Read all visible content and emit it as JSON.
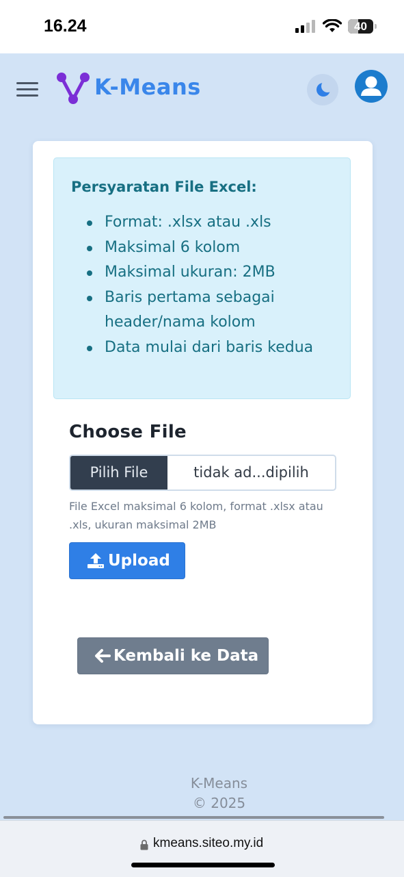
{
  "status_bar": {
    "time": "16.24",
    "battery_level": "40"
  },
  "header": {
    "brand": "K-Means",
    "icons": [
      "menu-icon",
      "logo-icon",
      "moon-icon",
      "user-icon"
    ]
  },
  "requirements": {
    "title": "Persyaratan File Excel:",
    "items": [
      "Format: .xlsx atau .xls",
      "Maksimal 6 kolom",
      "Maksimal ukuran: 2MB",
      "Baris pertama sebagai header/nama kolom",
      "Data mulai dari baris kedua"
    ]
  },
  "upload_form": {
    "heading": "Choose File",
    "choose_button": "Pilih File",
    "file_name": "tidak ad...dipilih",
    "help_text": "File Excel maksimal 6 kolom, format .xlsx atau .xls, ukuran maksimal 2MB",
    "upload_label": "Upload"
  },
  "back_button": {
    "label": "Kembali ke Data"
  },
  "footer": {
    "name": "K-Means",
    "copyright": "© 2025"
  },
  "browser": {
    "url": "kmeans.siteo.my.id"
  },
  "colors": {
    "page_background": "#d2e3f6",
    "brand": "#3a86ea",
    "alert_background": "#d9f1fb",
    "alert_text": "#176f82",
    "upload_button": "#2f7fe6",
    "back_button": "#6f7d8e"
  }
}
